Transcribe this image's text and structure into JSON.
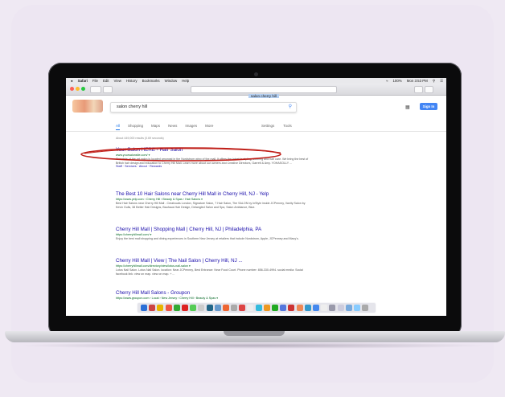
{
  "menubar": {
    "apple": "",
    "app": "Safari",
    "items": [
      "File",
      "Edit",
      "View",
      "History",
      "Bookmarks",
      "Window",
      "Help"
    ],
    "status": "100%",
    "clock": "Mon 3:53 PM"
  },
  "toolbar": {
    "url": "salon cherry hill"
  },
  "google": {
    "query": "salon cherry hill",
    "signin": "Sign In",
    "tabs": [
      "All",
      "Shopping",
      "Maps",
      "News",
      "Images",
      "More"
    ],
    "tools": [
      "Settings",
      "Tools"
    ],
    "stats": "About 449,000 results (0.69 seconds)"
  },
  "results": [
    {
      "title": "Your Salon HERE - Hair Salon",
      "url": "www.yoursalonsite.com/ ▾",
      "snippet": "Our state of the art salon is located amongst in the Nordstrom wing of the mall. It offers the latest in styling, coloring and hair care. We bring the best of British hair design and education to Cherry Hill Mall. Learn more about our owners and Creative Directors, Garrett & Amy. YOHASOLLY ...",
      "links": "Staff · Services · About · Rewards"
    },
    {
      "title": "The Best 10 Hair Salons near Cherry Hill Mall in Cherry Hill, NJ - Yelp",
      "url": "https://www.yelp.com › Cherry Hill › Beauty & Spas › Hair Salons ▾",
      "snippet": "Best Hair Salons near Cherry Hill Mall - Creatvuals London, Signature Salon, 7 Hair Salon, The SALON by InStyle inside JCPenney, Vanity Salon by Kevin Gulls, 38 Better Hair Designs, Bauhaus Hair Design, Detangled Salon and Spa, Salon Ambiance, Blue."
    },
    {
      "title": "Cherry Hill Mall | Shopping Mall | Cherry Hill, NJ | Philadelphia, PA",
      "url": "https://cherryhillmall.com/ ▾",
      "snippet": "Enjoy the best mall shopping and dining experiences in Southern New Jersey at retailers that include Nordstrom, Apple, JCPenney and Macy's."
    },
    {
      "title": "Cherry Hill Mall | View |  The Nail Salon | Cherry Hill, NJ ...",
      "url": "https://cherryhillmall.com/directory/view/lotus-nail-salon ▾",
      "snippet": "Lotus Nail Salon. Lotus Nail Salon. location: Near JCPenney, Best Entrance: Near Food Court. Phone number: 856-330-4994. social media: Social facebook link: view on map. view on map. + ..."
    },
    {
      "title": "Cherry Hill Mall Salons - Groupon",
      "url": "https://www.groupon.com › Local › New Jersey › Cherry Hill › Beauty & Spas ▾",
      "snippet": ""
    }
  ],
  "dock": {
    "colors": [
      "#2b6fd6",
      "#c44",
      "#e8b400",
      "#e54",
      "#3a3",
      "#d22",
      "#5c5",
      "#ccc",
      "#268",
      "#69c",
      "#e63",
      "#aaa",
      "#d44",
      "#eee",
      "#3bd",
      "#e92",
      "#2a2",
      "#57d",
      "#c33",
      "#e85",
      "#39c",
      "#48e",
      "#eee",
      "#99a",
      "#ccd",
      "#7ad",
      "#8cf",
      "#aaa"
    ]
  }
}
